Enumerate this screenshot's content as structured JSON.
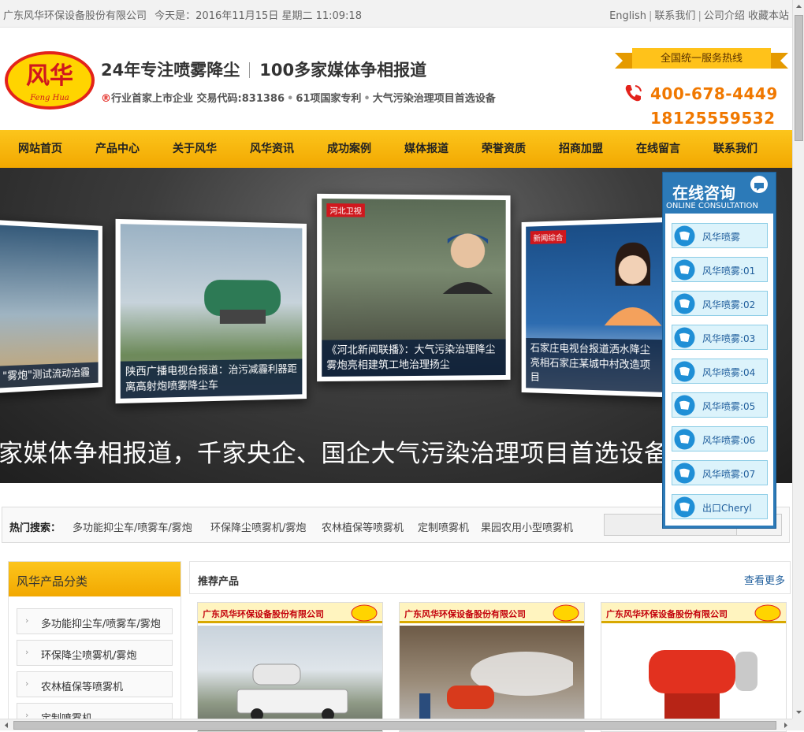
{
  "topbar": {
    "company": "广东风华环保设备股份有限公司",
    "date_text": "今天是：2016年11月15日 星期二 11:09:18",
    "links": [
      "English",
      "联系我们",
      "公司介绍",
      "收藏本站"
    ]
  },
  "header": {
    "logo_cn": "风华",
    "logo_en": "Feng Hua",
    "slogan_a": "24年专注喷雾降尘",
    "slogan_b": "100多家媒体争相报道",
    "sub_a": "行业首家上市企业 交易代码:831386",
    "sub_b": "61项国家专利",
    "sub_c": "大气污染治理项目首选设备",
    "hotline_label": "全国统一服务热线",
    "phone1": "400-678-4449",
    "phone2": "18125559532"
  },
  "nav": [
    "网站首页",
    "产品中心",
    "关于风华",
    "风华资讯",
    "成功案例",
    "媒体报道",
    "荣誉资质",
    "招商加盟",
    "在线留言",
    "联系我们"
  ],
  "banner": {
    "captions": [
      "\"雾炮\"测试流动治霾",
      "陕西广播电视台报道：治污减霾利器距离高射炮喷雾降尘车",
      "《河北新闻联播》：大气污染治理降尘雾炮亮相建筑工地治理扬尘",
      "石家庄电视台报道洒水降尘亮相石家庄某城中村改造项目"
    ],
    "tv_labels": [
      "河北卫视",
      "新闻综合"
    ],
    "bottom_text": "家媒体争相报道，千家央企、国企大气污染治理项目首选设备"
  },
  "hot_search": {
    "label": "热门搜索：",
    "keywords": [
      "多功能抑尘车/喷雾车/雾炮",
      "环保降尘喷雾机/雾炮",
      "农林植保等喷雾机",
      "定制喷雾机",
      "果园农用小型喷雾机"
    ]
  },
  "categories": {
    "title": "风华产品分类",
    "items": [
      "多功能抑尘车/喷雾车/雾炮",
      "环保降尘喷雾机/雾炮",
      "农林植保等喷雾机",
      "定制喷雾机"
    ]
  },
  "recommend": {
    "title": "推荐产品",
    "more": "查看更多",
    "card_company": "广东风华环保设备股份有限公司"
  },
  "chat": {
    "title": "在线咨询",
    "subtitle": "ONLINE CONSULTATION",
    "items": [
      "风华喷雾",
      "风华喷雾:01",
      "风华喷雾:02",
      "风华喷雾:03",
      "风华喷雾:04",
      "风华喷雾:05",
      "风华喷雾:06",
      "风华喷雾:07",
      "出口Cheryl"
    ]
  },
  "colors": {
    "nav_yellow": "#f7b500",
    "accent_orange": "#f07800",
    "chat_blue": "#2c7ab8"
  }
}
